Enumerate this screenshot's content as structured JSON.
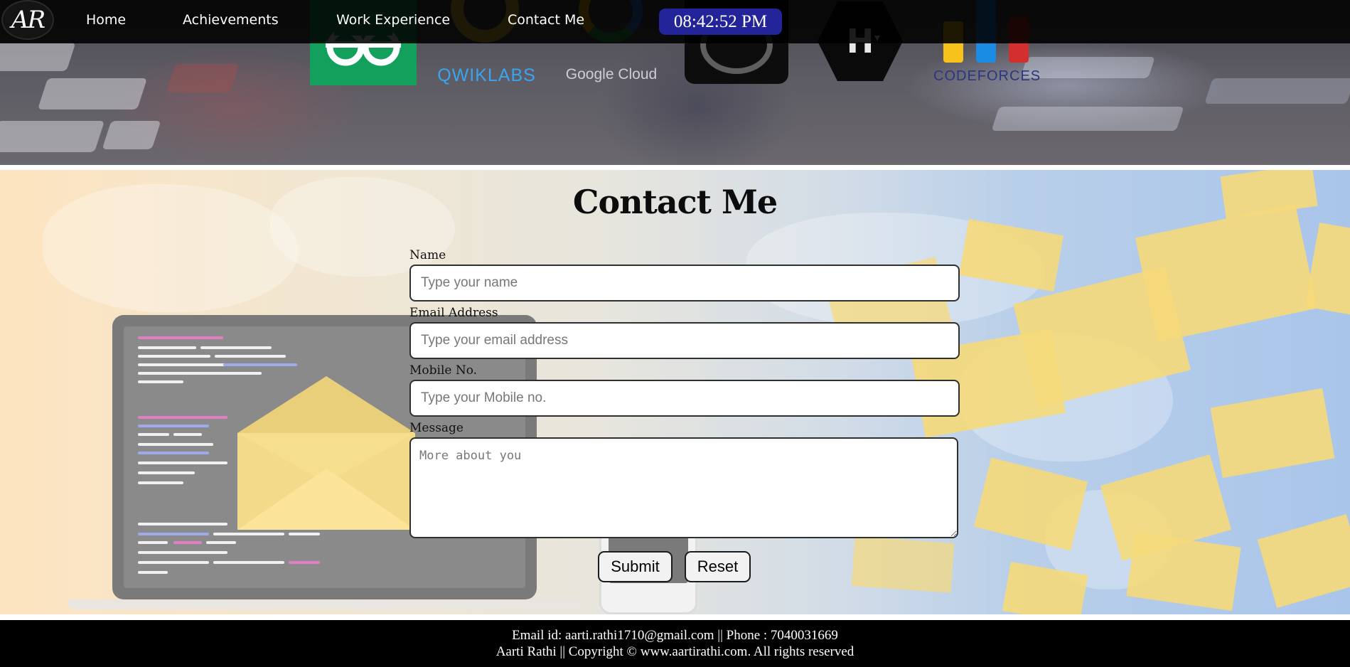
{
  "nav": {
    "logo_text": "AR",
    "links": [
      "Home",
      "Achievements",
      "Work Experience",
      "Contact Me"
    ],
    "clock": "08:42:52 PM"
  },
  "certifications": {
    "qwiklabs": "QWIKLABS",
    "google_cloud": "Google Cloud",
    "codeforces": "CODEFORCES",
    "hackerrank_letter": "H"
  },
  "contact": {
    "title": "Contact Me",
    "name": {
      "label": "Name",
      "placeholder": "Type your name",
      "value": ""
    },
    "email": {
      "label": "Email Address",
      "placeholder": "Type your email address",
      "value": ""
    },
    "mobile": {
      "label": "Mobile No.",
      "placeholder": "Type your Mobile no.",
      "value": ""
    },
    "message": {
      "label": "Message",
      "placeholder": "More about you",
      "value": ""
    },
    "submit_label": "Submit",
    "reset_label": "Reset"
  },
  "footer": {
    "line1": "Email id: aarti.rathi1710@gmail.com || Phone : 7040031669",
    "line2": "Aarti Rathi || Copyright © www.aartirathi.com. All rights reserved"
  },
  "colors": {
    "clock_bg": "#23239a",
    "geeksforgeeks_green": "#12a05c",
    "qwiklabs_yellow": "#f1c232",
    "qwiklabs_blue": "#3aa5ee",
    "codeforces_yellow": "#f7c31a",
    "codeforces_blue": "#1a8ce3",
    "codeforces_red": "#d32f2f"
  }
}
